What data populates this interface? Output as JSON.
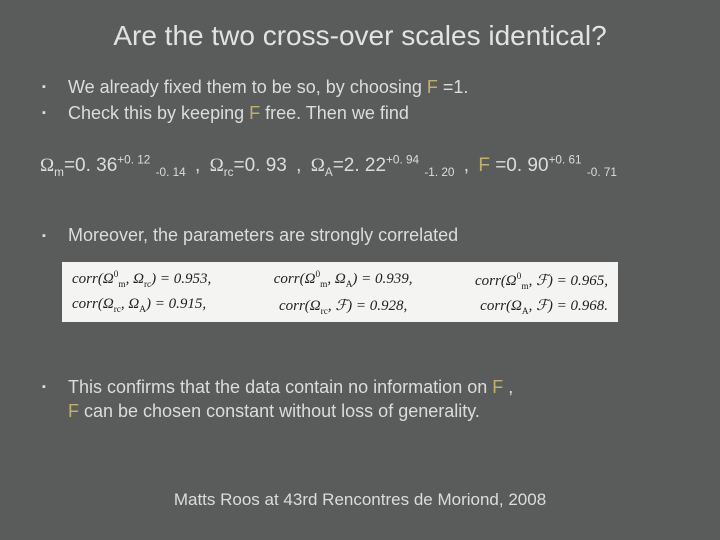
{
  "title": "Are the two cross-over scales identical?",
  "b1": {
    "line1a": "We already fixed them to be so, by choosing ",
    "line1F": "F",
    "line1b": " =1.",
    "line2a": "Check this by keeping ",
    "line2F": "F",
    "line2b": " free. Then we find"
  },
  "eq": {
    "omega_m_label": "Ω",
    "m_sub": "m",
    "m_val": "=0. 36",
    "m_up": "+0. 12",
    "m_dn": "-0. 14",
    "sep1": " ,  ",
    "omega_rc_label": "Ω",
    "rc_sub": "rc",
    "rc_val": "=0. 93",
    "sep2": " ,  ",
    "omega_A_label": "Ω",
    "A_sub": "A",
    "A_val": "=2. 22",
    "A_up": "+0. 94",
    "A_dn": "-1. 20",
    "sep3": " ,  ",
    "F_label": "F",
    "F_val": " =0. 90",
    "F_up": "+0. 61",
    "F_dn": "-0. 71"
  },
  "b2": "Moreover, the parameters are strongly correlated",
  "corr": {
    "l1a": "corr(Ω",
    "l1a2": ", Ω",
    "l1a3": ") = 0.953,",
    "l1b": "corr(Ω",
    "l1b2": ", Ω",
    "l1b3": ") = 0.939,",
    "l1c": "corr(Ω",
    "l1c2": ", ℱ) = 0.965,",
    "l2a": "corr(Ω",
    "l2a2": ", Ω",
    "l2a3": ") = 0.915,",
    "l2b": "corr(Ω",
    "l2b2": ", ℱ) = 0.928,",
    "l2c": "corr(Ω",
    "l2c2": ", ℱ) = 0.968.",
    "sub_m0": "0",
    "sub_m": "m",
    "sub_rc": "rc",
    "sub_A": "A"
  },
  "b3": {
    "line1a": "This confirms that the data contain no information on ",
    "line1F": "F",
    "line1b": " ,",
    "line2F": "F",
    "line2": " can be  chosen constant without loss of generality."
  },
  "footer": "Matts Roos at 43rd Rencontres de Moriond, 2008",
  "chart_data": {
    "type": "table",
    "title": "Parameter fit results and correlations",
    "parameters": [
      {
        "name": "Ω_m",
        "value": 0.36,
        "err_up": 0.12,
        "err_down": 0.14
      },
      {
        "name": "Ω_rc",
        "value": 0.93
      },
      {
        "name": "Ω_A",
        "value": 2.22,
        "err_up": 0.94,
        "err_down": 1.2
      },
      {
        "name": "F",
        "value": 0.9,
        "err_up": 0.61,
        "err_down": 0.71
      }
    ],
    "correlations": [
      {
        "pair": [
          "Ω_m^0",
          "Ω_rc"
        ],
        "value": 0.953
      },
      {
        "pair": [
          "Ω_m^0",
          "Ω_A"
        ],
        "value": 0.939
      },
      {
        "pair": [
          "Ω_m^0",
          "F"
        ],
        "value": 0.965
      },
      {
        "pair": [
          "Ω_rc",
          "Ω_A"
        ],
        "value": 0.915
      },
      {
        "pair": [
          "Ω_rc",
          "F"
        ],
        "value": 0.928
      },
      {
        "pair": [
          "Ω_A",
          "F"
        ],
        "value": 0.968
      }
    ]
  }
}
